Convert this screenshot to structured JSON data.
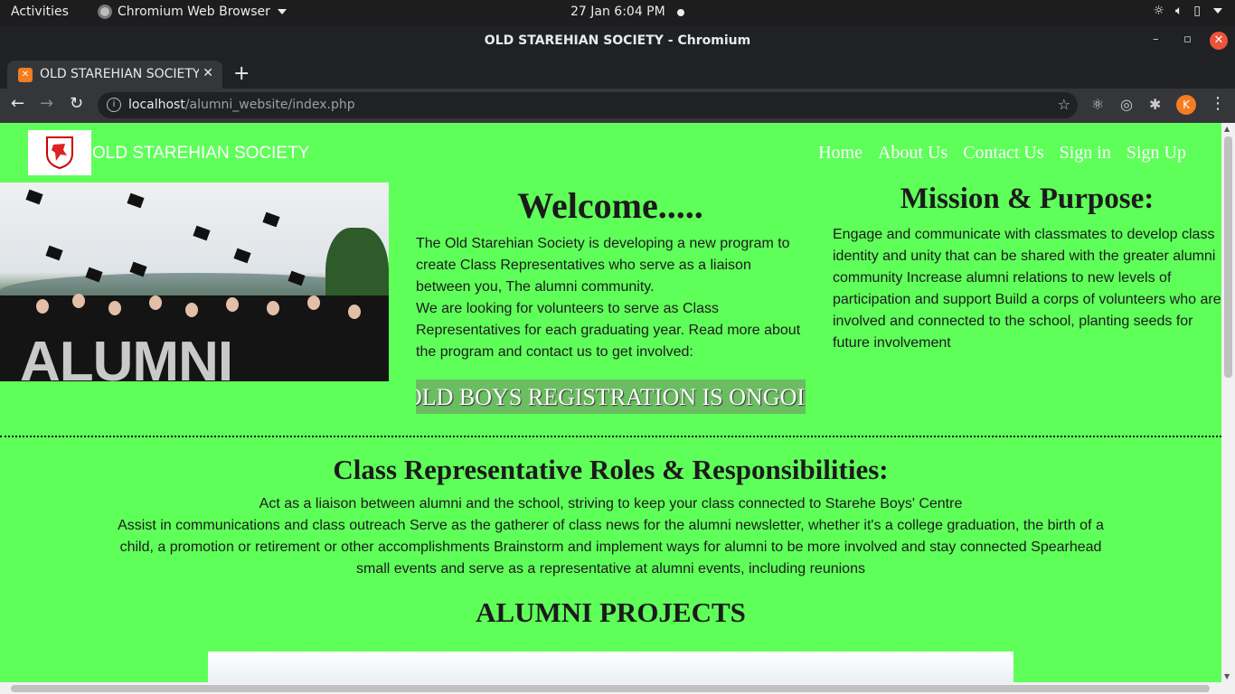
{
  "os_bar": {
    "activities": "Activities",
    "app_name": "Chromium Web Browser",
    "clock": "27 Jan  6:04 PM"
  },
  "browser": {
    "window_title": "OLD STAREHIAN SOCIETY - Chromium",
    "tab_title": "OLD STAREHIAN SOCIETY",
    "url_host": "localhost",
    "url_path": "/alumni_website/index.php",
    "profile_initial": "K"
  },
  "site": {
    "brand": "OLD STAREHIAN SOCIETY",
    "nav": {
      "home": "Home",
      "about": "About Us",
      "contact": "Contact Us",
      "signin": "Sign in",
      "signup": "Sign Up"
    },
    "hero_word": "ALUMNI",
    "welcome": {
      "title": "Welcome.....",
      "p1": "The Old Starehian Society is developing a new program to create Class Representatives who serve as a liaison between you, The alumni community.",
      "p2": "We are looking for volunteers to serve as Class Representatives for each graduating year. Read more about the program and contact us to get involved:"
    },
    "marquee": "OLD BOYS REGISTRATION IS ONGOING",
    "mission": {
      "title": "Mission & Purpose:",
      "text": "Engage and communicate with classmates to develop class identity and unity that can be shared with the greater alumni community Increase alumni relations to new levels of participation and support Build a corps of volunteers who are involved and connected to the school, planting seeds for future involvement"
    },
    "roles": {
      "title": "Class Representative Roles & Responsibilities:",
      "line1": "Act as a liaison between alumni and the school, striving to keep your class connected to Starehe Boys' Centre",
      "line2": "Assist in communications and class outreach Serve as the gatherer of class news for the alumni newsletter, whether it's a college graduation, the birth of a child, a promotion or retirement or other accomplishments Brainstorm and implement ways for alumni to be more involved and stay connected Spearhead small events and serve as a representative at alumni events, including reunions"
    },
    "projects_title": "ALUMNI PROJECTS"
  },
  "colors": {
    "page_bg": "#5fff5a",
    "marquee_bg": "#6abd60"
  }
}
